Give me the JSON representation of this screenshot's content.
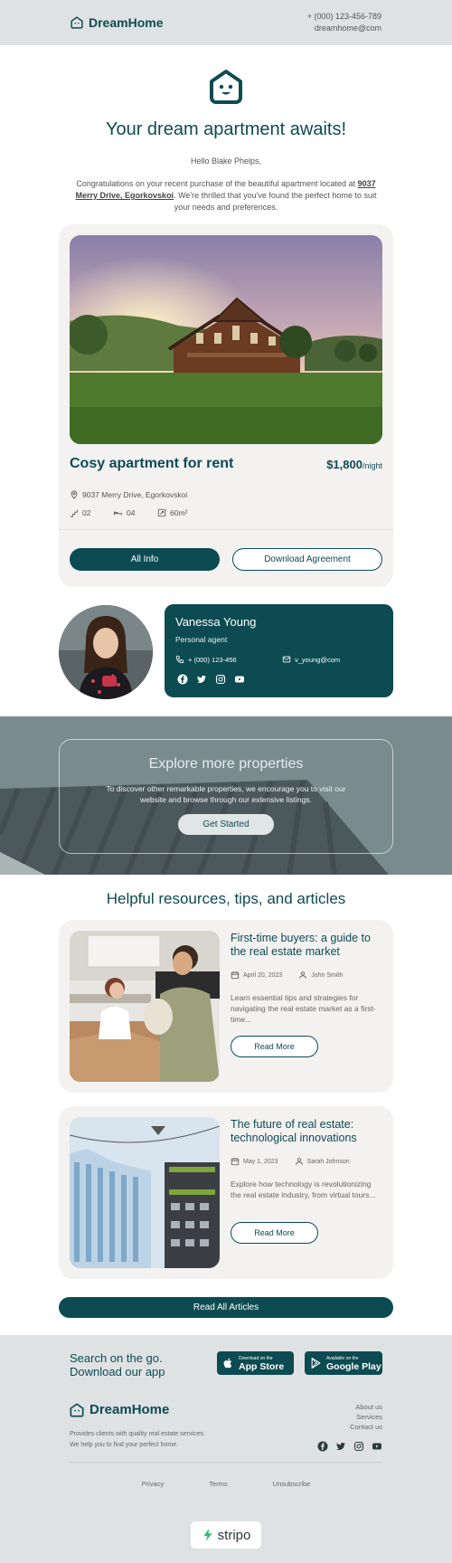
{
  "header": {
    "brand": "DreamHome",
    "phone": "+ (000) 123-456-789",
    "email": "dreamhome@com"
  },
  "hero": {
    "title": "Your dream apartment awaits!",
    "greeting": "Hello Blake Phelps,",
    "message_before": "Congratulations on your recent purchase of the beautiful apartment located at ",
    "address_link": "9037 Merry Drive, Egorkovskoi",
    "message_after": ". We're thrilled that you've found the perfect home to suit your needs and preferences."
  },
  "property": {
    "title": "Cosy apartment for rent",
    "price": "$1,800",
    "price_unit": "/night",
    "address": "9037 Merry Drive, Egorkovskoi",
    "stairs": "02",
    "beds": "04",
    "area": "60m²",
    "all_info_label": "All Info",
    "download_label": "Download Agreement"
  },
  "agent": {
    "name": "Vanessa Young",
    "role": "Personal agent",
    "phone": "+ (000) 123-456",
    "email": "v_young@com"
  },
  "explore": {
    "title": "Explore more properties",
    "text": "To discover other remarkable properties, we encourage you to visit our website and browse through our extensive listings.",
    "button": "Get Started"
  },
  "resources": {
    "title": "Helpful resources, tips, and articles",
    "articles": [
      {
        "title": "First-time buyers: a guide to the real estate market",
        "date": "April 20, 2023",
        "author": "John Smith",
        "excerpt": "Learn essential tips and strategies for navigating the real estate market as a first-time...",
        "button": "Read More"
      },
      {
        "title": "The future of real estate: technological innovations",
        "date": "May 1, 2023",
        "author": "Sarah Johnson",
        "excerpt": "Explore how technology is revolutionizing the real estate industry, from virtual tours...",
        "button": "Read More"
      }
    ],
    "read_all": "Read All Articles"
  },
  "footer": {
    "app_text_line1": "Search on the go.",
    "app_text_line2": "Download our app",
    "appstore_small": "Download on the",
    "appstore_big": "App Store",
    "googleplay_small": "Available on the",
    "googleplay_big": "Google Play",
    "brand": "DreamHome",
    "desc_line1": "Provides clients with quality real estate services.",
    "desc_line2": "We help you to find your perfect home.",
    "links": [
      "About us",
      "Services",
      "Contact us"
    ],
    "bottom_links": [
      "Privacy",
      "Terms",
      "Unsubscribe"
    ],
    "stripo": "stripo"
  },
  "colors": {
    "accent": "#0d4b52",
    "card_bg": "#f3f2f0",
    "footer_bg": "#dfe2e3"
  }
}
